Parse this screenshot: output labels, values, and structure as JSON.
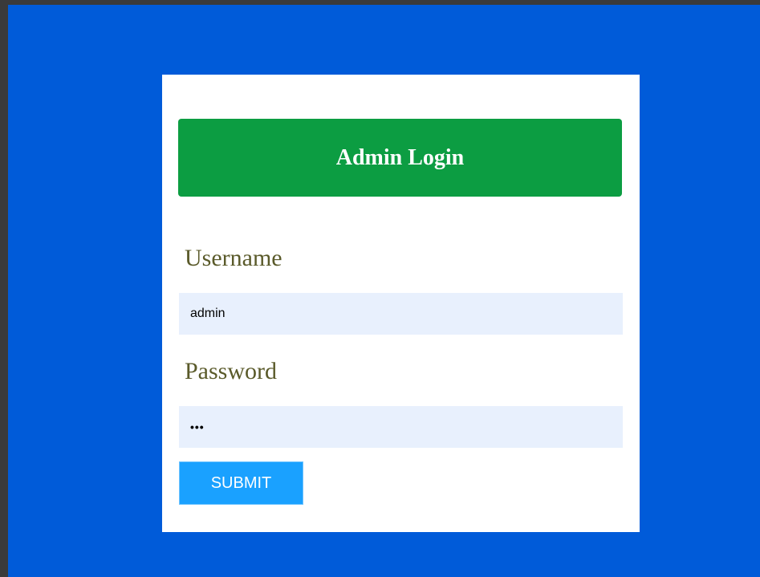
{
  "header": {
    "title": "Admin Login",
    "color": "#0c9d42"
  },
  "form": {
    "username": {
      "label": "Username",
      "value": "admin"
    },
    "password": {
      "label": "Password",
      "value": "•••"
    },
    "submit_label": "SUBMIT"
  },
  "colors": {
    "background": "#005bd9",
    "card": "#ffffff",
    "input_background": "#e8f0fd",
    "submit": "#1aa1ff"
  }
}
